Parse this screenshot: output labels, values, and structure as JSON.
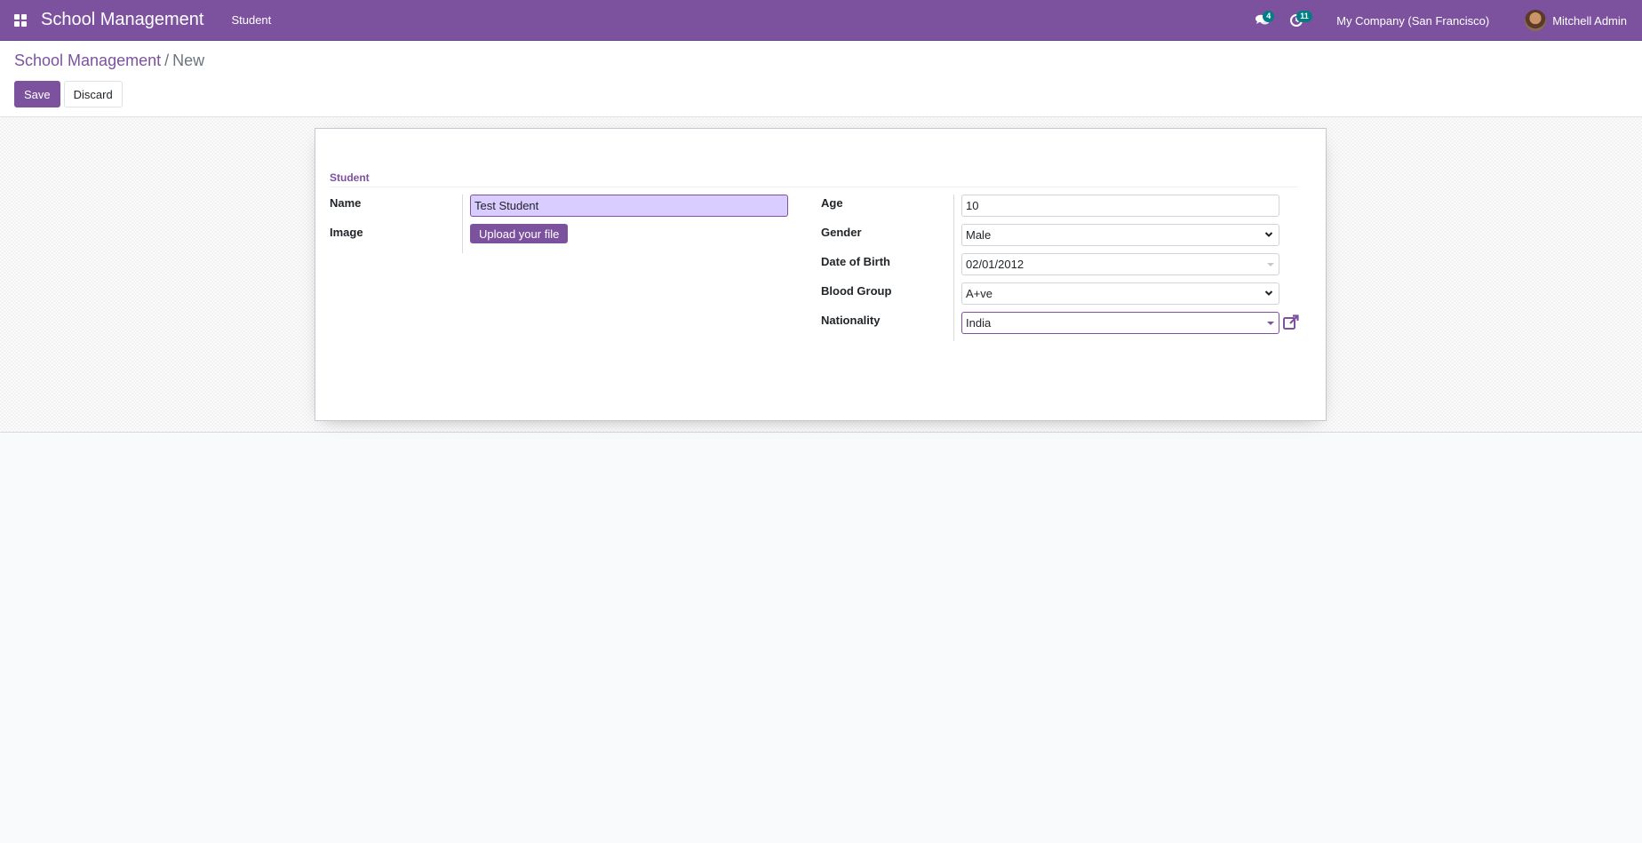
{
  "navbar": {
    "app_title": "School Management",
    "menu_items": [
      "Student"
    ],
    "messages_badge": "4",
    "activities_badge": "11",
    "company": "My Company (San Francisco)",
    "user": "Mitchell Admin"
  },
  "breadcrumb": {
    "parent": "School Management",
    "separator": "/",
    "current": "New"
  },
  "buttons": {
    "save": "Save",
    "discard": "Discard"
  },
  "form": {
    "group_title": "Student",
    "left": {
      "name_label": "Name",
      "name_value": "Test Student",
      "image_label": "Image",
      "upload_label": "Upload your file"
    },
    "right": {
      "age_label": "Age",
      "age_value": "10",
      "gender_label": "Gender",
      "gender_value": "Male",
      "dob_label": "Date of Birth",
      "dob_value": "02/01/2012",
      "blood_label": "Blood Group",
      "blood_value": "A+ve",
      "nationality_label": "Nationality",
      "nationality_value": "India"
    }
  },
  "colors": {
    "brand": "#7c529f",
    "badge": "#017e84",
    "name_field_bg": "#d9ccff"
  }
}
